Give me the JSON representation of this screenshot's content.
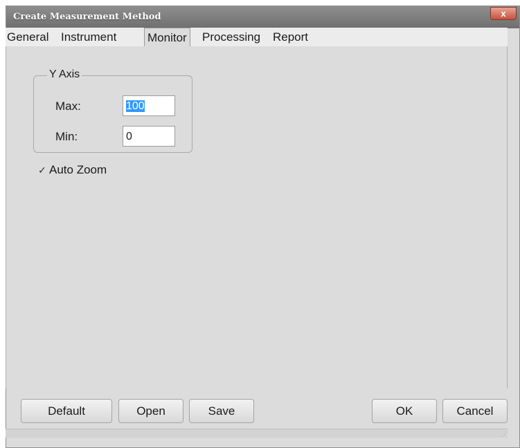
{
  "window": {
    "title": "Create Measurement Method",
    "close_glyph": "x"
  },
  "tabs": [
    {
      "label": "General"
    },
    {
      "label": "Instrument"
    },
    {
      "label": "Monitor",
      "active": true
    },
    {
      "label": "Processing"
    },
    {
      "label": "Report"
    }
  ],
  "y_axis": {
    "group_title": "Y Axis",
    "max_label": "Max:",
    "max_value": "100",
    "min_label": "Min:",
    "min_value": "0"
  },
  "auto_zoom": {
    "label": "Auto Zoom",
    "checked": true,
    "check_glyph": "✓"
  },
  "buttons": {
    "default": "Default",
    "open": "Open",
    "save": "Save",
    "ok": "OK",
    "cancel": "Cancel"
  }
}
